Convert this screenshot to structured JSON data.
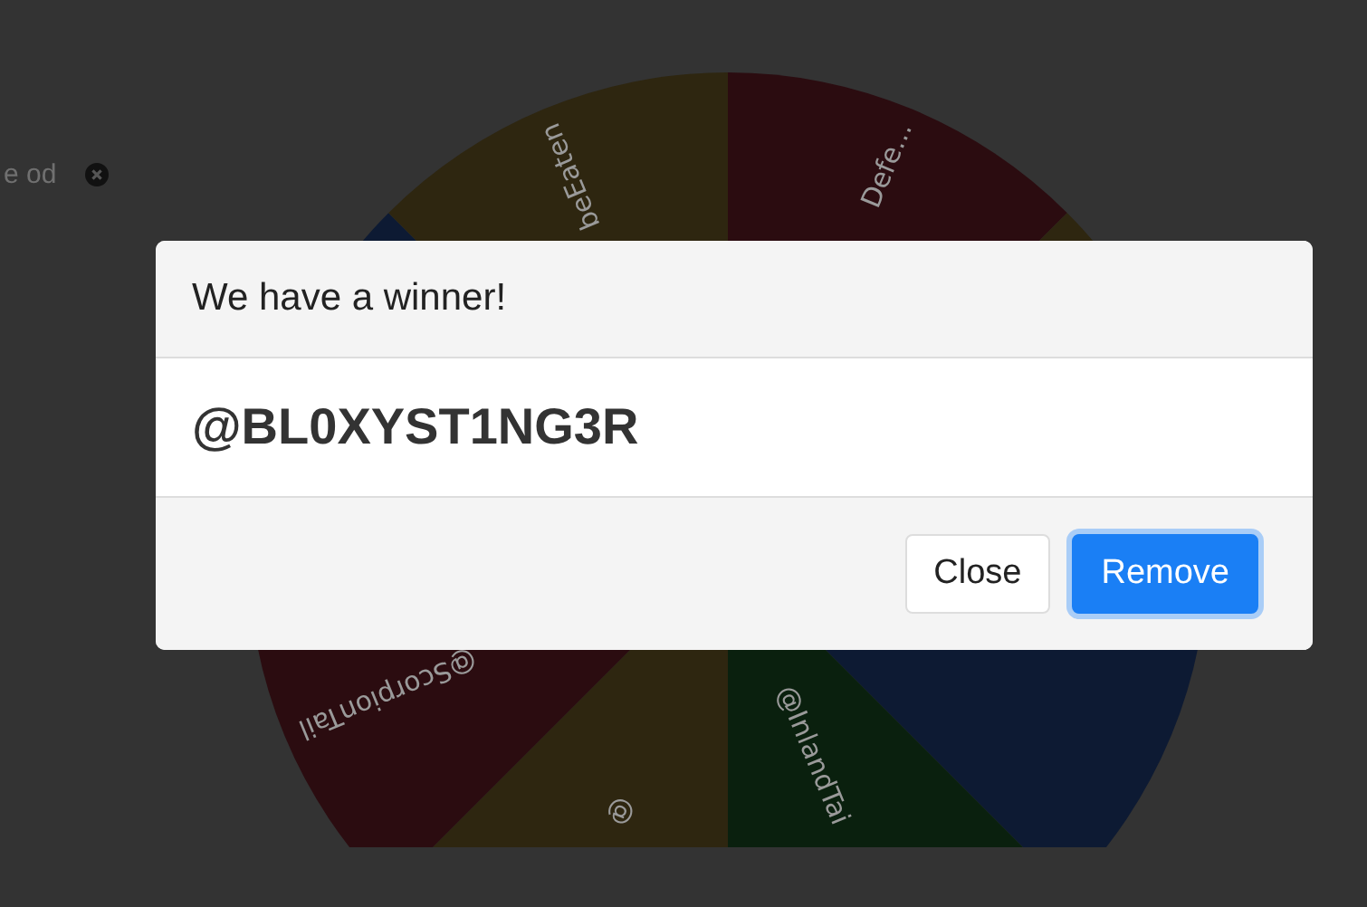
{
  "background": {
    "entry": {
      "text": "e od"
    }
  },
  "wheel": {
    "segments": [
      {
        "color": "#2b0c10",
        "label": "Defe..."
      },
      {
        "color": "#2e2610"
      },
      {
        "color": "#0d1a33"
      },
      {
        "color": "#0a200e",
        "label": "@InlandTai"
      },
      {
        "color": "#2e2610",
        "label": "@"
      },
      {
        "color": "#2b0c10",
        "label": "@ScorpionTail"
      },
      {
        "color": "#0d1a33"
      },
      {
        "color": "#2e2610",
        "label": "beEaten"
      }
    ]
  },
  "dialog": {
    "title": "We have a winner!",
    "winner": "@BL0XYST1NG3R",
    "buttons": [
      {
        "label": "Close",
        "kind": "secondary"
      },
      {
        "label": "Remove",
        "kind": "primary"
      }
    ]
  }
}
